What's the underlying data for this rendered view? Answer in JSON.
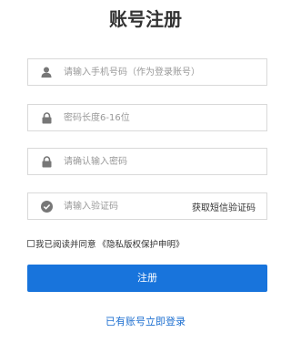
{
  "page": {
    "title": "账号注册"
  },
  "form": {
    "phone": {
      "placeholder": "请输入手机号码（作为登录账号）",
      "icon": "user-icon"
    },
    "password": {
      "placeholder": "密码长度6-16位",
      "icon": "lock-icon"
    },
    "confirm": {
      "placeholder": "请确认输入密码",
      "icon": "lock-icon"
    },
    "code": {
      "placeholder": "请输入验证码",
      "icon": "check-circle-icon",
      "sms_button": "获取短信验证码"
    }
  },
  "agreement": {
    "text": "我已阅读并同意",
    "policy": "《隐私版权保护申明》"
  },
  "submit_label": "注册",
  "login_link": "已有账号立即登录",
  "colors": {
    "primary": "#1874dc",
    "link": "#1d6fd0",
    "icon": "#777777",
    "border": "#d9d9d9"
  }
}
